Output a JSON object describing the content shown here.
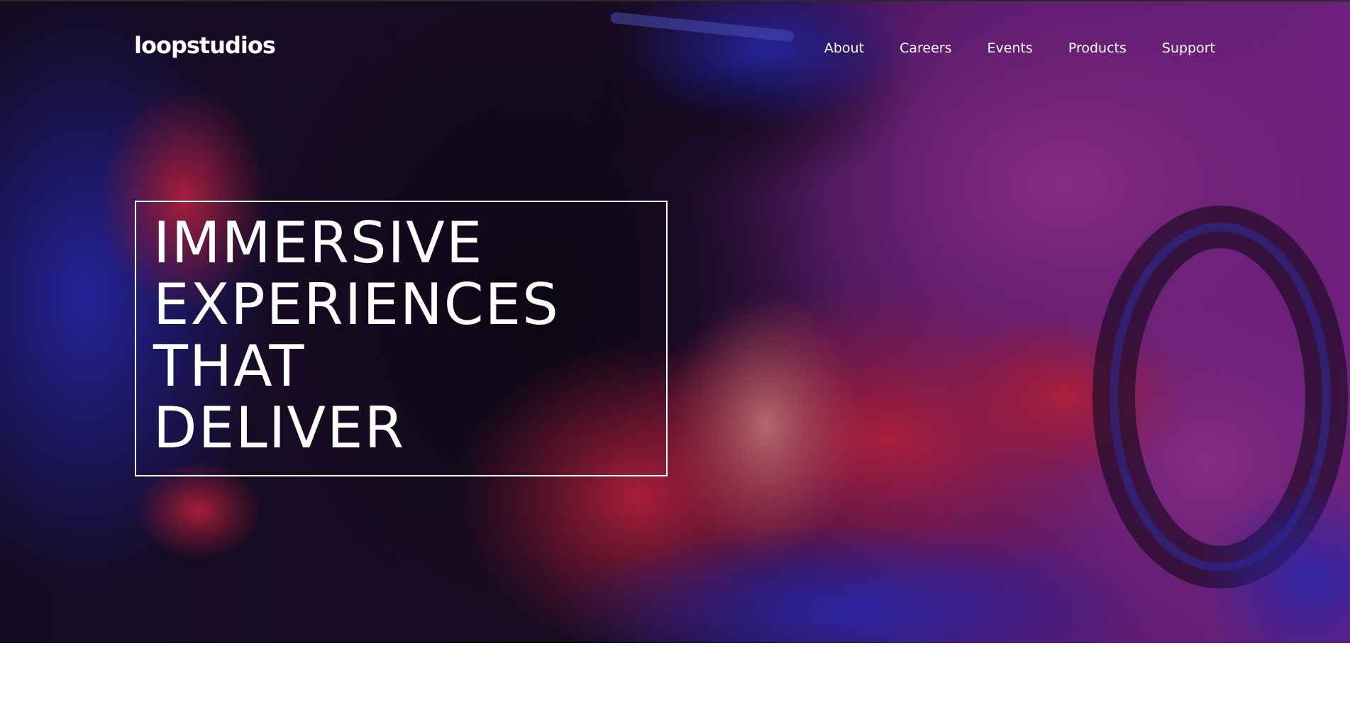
{
  "brand": {
    "logo_text": "loopstudios"
  },
  "nav": {
    "items": [
      {
        "label": "About"
      },
      {
        "label": "Careers"
      },
      {
        "label": "Events"
      },
      {
        "label": "Products"
      },
      {
        "label": "Support"
      }
    ]
  },
  "hero": {
    "headline_lines": [
      "IMMERSIVE",
      "EXPERIENCES",
      "THAT",
      "DELIVER"
    ],
    "image_semantic": "vr-racing-gamer-photo",
    "colors": {
      "base": "#1e0f33",
      "magenta": "#9b2aa8",
      "red": "#d8254a",
      "blue": "#2b2fd0"
    }
  }
}
